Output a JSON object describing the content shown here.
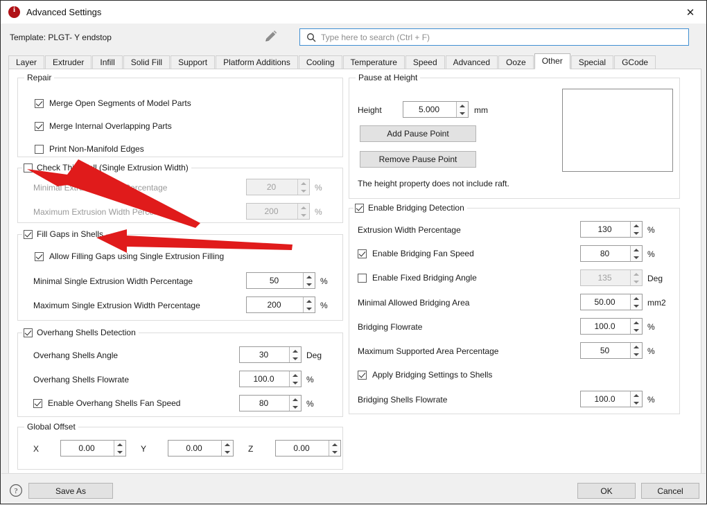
{
  "window": {
    "title": "Advanced Settings",
    "app_icon": "info-icon",
    "close_label": "✕"
  },
  "template": {
    "label": "Template: PLGT- Y endstop",
    "edit_icon": "pencil-icon"
  },
  "search": {
    "icon": "search-icon",
    "placeholder": "Type here to search (Ctrl + F)",
    "value": ""
  },
  "tabs": [
    {
      "label": "Layer",
      "active": false
    },
    {
      "label": "Extruder",
      "active": false
    },
    {
      "label": "Infill",
      "active": false
    },
    {
      "label": "Solid Fill",
      "active": false
    },
    {
      "label": "Support",
      "active": false
    },
    {
      "label": "Platform Additions",
      "active": false
    },
    {
      "label": "Cooling",
      "active": false
    },
    {
      "label": "Temperature",
      "active": false
    },
    {
      "label": "Speed",
      "active": false
    },
    {
      "label": "Advanced",
      "active": false
    },
    {
      "label": "Ooze",
      "active": false
    },
    {
      "label": "Other",
      "active": true
    },
    {
      "label": "Special",
      "active": false
    },
    {
      "label": "GCode",
      "active": false
    }
  ],
  "repair": {
    "title": "Repair",
    "items": [
      {
        "label": "Merge Open Segments of Model Parts",
        "checked": true
      },
      {
        "label": "Merge Internal Overlapping Parts",
        "checked": true
      },
      {
        "label": "Print Non-Manifold Edges",
        "checked": false
      }
    ]
  },
  "thin_wall": {
    "title": "Check Thin Wall (Single Extrusion Width)",
    "checked": false,
    "rows": [
      {
        "label": "Minimal Extrusion Width Percentage",
        "value": "20",
        "unit": "%",
        "disabled": true
      },
      {
        "label": "Maximum Extrusion Width Percentage",
        "value": "200",
        "unit": "%",
        "disabled": true
      }
    ]
  },
  "fill_gaps": {
    "title": "Fill Gaps in Shells",
    "checked": true,
    "sub_checkbox": {
      "label": "Allow Filling Gaps using Single Extrusion Filling",
      "checked": true
    },
    "rows": [
      {
        "label": "Minimal Single Extrusion Width Percentage",
        "value": "50",
        "unit": "%",
        "disabled": false
      },
      {
        "label": "Maximum Single Extrusion Width Percentage",
        "value": "200",
        "unit": "%",
        "disabled": false
      }
    ]
  },
  "overhang": {
    "title": "Overhang Shells Detection",
    "checked": true,
    "rows": [
      {
        "label": "Overhang Shells Angle",
        "value": "30",
        "unit": "Deg"
      },
      {
        "label": "Overhang Shells Flowrate",
        "value": "100.0",
        "unit": "%"
      }
    ],
    "fan_speed": {
      "label": "Enable Overhang Shells Fan Speed",
      "checked": true,
      "value": "80",
      "unit": "%"
    }
  },
  "global_offset": {
    "title": "Global Offset",
    "axes": [
      {
        "label": "X",
        "value": "0.00"
      },
      {
        "label": "Y",
        "value": "0.00"
      },
      {
        "label": "Z",
        "value": "0.00"
      }
    ]
  },
  "pause_at_height": {
    "title": "Pause at Height",
    "height_label": "Height",
    "height_value": "5.000",
    "height_unit": "mm",
    "add_button": "Add Pause Point",
    "remove_button": "Remove Pause Point",
    "note": "The height property does not include raft.",
    "list_items": []
  },
  "bridging": {
    "title": "Enable Bridging Detection",
    "checked": true,
    "extrusion_width": {
      "label": "Extrusion Width Percentage",
      "value": "130",
      "unit": "%"
    },
    "fan_speed": {
      "label": "Enable Bridging Fan Speed",
      "checked": true,
      "value": "80",
      "unit": "%"
    },
    "fixed_angle": {
      "label": "Enable Fixed Bridging Angle",
      "checked": false,
      "value": "135",
      "unit": "Deg",
      "disabled": true
    },
    "min_area": {
      "label": "Minimal Allowed Bridging Area",
      "value": "50.00",
      "unit": "mm2"
    },
    "flowrate": {
      "label": "Bridging Flowrate",
      "value": "100.0",
      "unit": "%"
    },
    "max_supported": {
      "label": "Maximum Supported Area Percentage",
      "value": "50",
      "unit": "%"
    },
    "apply_shells": {
      "label": "Apply Bridging Settings to Shells",
      "checked": true
    },
    "shells_flowrate": {
      "label": "Bridging Shells Flowrate",
      "value": "100.0",
      "unit": "%"
    }
  },
  "footer": {
    "help_icon": "question-mark-icon",
    "save_as": "Save As",
    "ok": "OK",
    "cancel": "Cancel"
  },
  "annotations": {
    "arrow_color": "#e01b1b",
    "arrows": [
      {
        "name": "arrow-to-check-thin-wall",
        "target": "Check Thin Wall (Single Extrusion Width)"
      },
      {
        "name": "arrow-to-fill-gaps-in-shells",
        "target": "Fill Gaps in Shells"
      }
    ]
  }
}
